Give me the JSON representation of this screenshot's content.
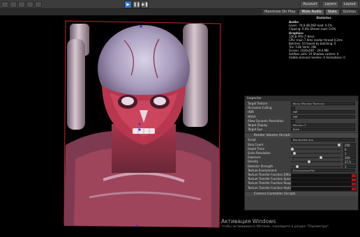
{
  "toolbar": {
    "play_icons": [
      "play-icon",
      "pause-icon",
      "step-icon"
    ],
    "account_label": "Account",
    "layers_label": "Layers",
    "layout_label": "Layout"
  },
  "game_view": {
    "tabs": [
      "Maximize On Play",
      "Mute Audio",
      "Stats",
      "Gizmos"
    ]
  },
  "stats": {
    "title": "Statistics",
    "audio_label": "Audio:",
    "audio_rows": [
      "Level: -74.8 dB          DSP load: 0.1%",
      "Clipping: 0.0%            Stream load: 0.0%"
    ],
    "graphics_label": "Graphics:",
    "graphics_rows": [
      "                          126.8 FPS (7.9ms)",
      "CPU: main 7.9ms  render thread 0.2ms",
      "Batches: 10    Saved by batching: 0",
      "Tris: 5.8k       Verts: 29k",
      "Screen: 1020x587 - 29.4 MB",
      "SetPass calls: 10   Shadow casters: 0",
      "Visible skinned meshes: 0  Animations: 0"
    ]
  },
  "inspector": {
    "title": "Inspector",
    "rows": [
      {
        "label": "Target Texture",
        "value": "None (Render Texture)",
        "kind": "field"
      },
      {
        "label": "Occlusion Culling",
        "value": "",
        "kind": "check"
      },
      {
        "label": "HDR",
        "value": "Off",
        "kind": "field"
      },
      {
        "label": "MSAA",
        "value": "Off",
        "kind": "field"
      },
      {
        "label": "Allow Dynamic Resolution",
        "value": "",
        "kind": "check"
      },
      {
        "label": "Target Display",
        "value": "Display 1",
        "kind": "field"
      },
      {
        "label": "Target Eye",
        "value": "Both",
        "kind": "field"
      }
    ],
    "component1": "Render Volume (Script)",
    "rows2": [
      {
        "label": "Script",
        "value": "RenderVolume",
        "kind": "field"
      },
      {
        "label": "Step Count",
        "value": "256",
        "kind": "slider",
        "level": 0.98
      },
      {
        "label": "Depth Trace",
        "value": "0",
        "kind": "slider",
        "level": 0.0
      },
      {
        "label": "Scale Resolution",
        "value": "1",
        "kind": "slider",
        "level": 0.05
      },
      {
        "label": "Exposure",
        "value": "100",
        "kind": "slider",
        "level": 0.6
      },
      {
        "label": "Density",
        "value": "27.5",
        "kind": "slider",
        "level": 0.35
      },
      {
        "label": "Detector Strength",
        "value": "1",
        "kind": "slider",
        "level": 0.1
      },
      {
        "label": "Texture Environment",
        "value": "Environment3d",
        "kind": "field"
      },
      {
        "label": "Texture Transfer Function Diffuse",
        "value": "",
        "kind": "swatch"
      },
      {
        "label": "Texture Transfer Function Specular",
        "value": "",
        "kind": "swatch"
      },
      {
        "label": "Texture Transfer Function Roughness",
        "value": "",
        "kind": "swatch"
      },
      {
        "label": "Texture Transfer Function Alpha",
        "value": "",
        "kind": "swatch"
      }
    ],
    "component2": "Camera Controller (Script)"
  },
  "watermark": {
    "line1": "Активация Windows",
    "line2": "Чтобы активировать Windows, перейдите в раздел \"Параметры\"."
  }
}
